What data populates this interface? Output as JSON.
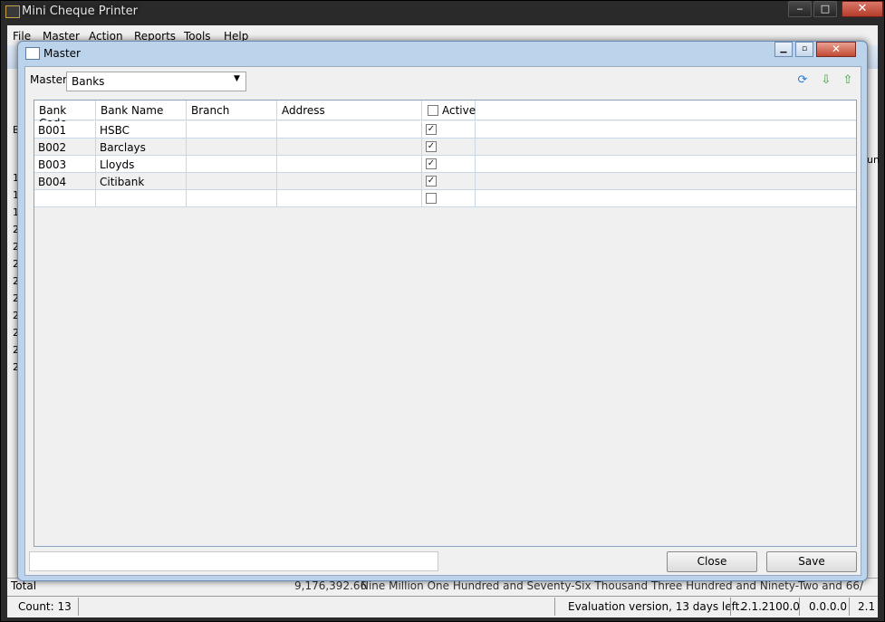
{
  "app": {
    "title": "Mini Cheque Printer",
    "minimize": "‒",
    "maximize": "□",
    "close": "✕"
  },
  "menu": [
    "File",
    "Master",
    "Action",
    "Reports",
    "Tools",
    "Help"
  ],
  "background": {
    "left_letters": [
      "B",
      "1",
      "1",
      "1",
      "2",
      "2",
      "2",
      "2",
      "2",
      "2",
      "2",
      "2",
      "2"
    ],
    "right_fragment": "un",
    "total_label": "Total",
    "total_amount": "9,176,392.66",
    "total_words": "Nine Million One Hundred and Seventy-Six Thousand Three Hundred and Ninety-Two and 66/"
  },
  "statusbar": {
    "count": "Count: 13",
    "evaluation": "Evaluation version, 13 days left.",
    "version1": "2.1.2100.0",
    "version2": "0.0.0.0",
    "version3": "2.1"
  },
  "dialog": {
    "title": "Master",
    "master_label": "Master",
    "master_value": "Banks",
    "icons": [
      "refresh-icon",
      "import-icon",
      "export-icon"
    ],
    "close_button": "Close",
    "save_button": "Save"
  },
  "grid": {
    "columns": [
      "Bank Code",
      "Bank Name",
      "Branch",
      "Address",
      "Active"
    ],
    "rows": [
      {
        "code": "B001",
        "name": "HSBC",
        "branch": "",
        "address": "",
        "active": true
      },
      {
        "code": "B002",
        "name": "Barclays",
        "branch": "",
        "address": "",
        "active": true
      },
      {
        "code": "B003",
        "name": "Lloyds",
        "branch": "",
        "address": "",
        "active": true
      },
      {
        "code": "B004",
        "name": "Citibank",
        "branch": "",
        "address": "",
        "active": true
      },
      {
        "code": "",
        "name": "",
        "branch": "",
        "address": "",
        "active": false
      }
    ]
  },
  "colors": {
    "dialog_frame": "#bcd3ec",
    "grid_line": "#c6d7e8",
    "close_red": "#c24a34"
  }
}
